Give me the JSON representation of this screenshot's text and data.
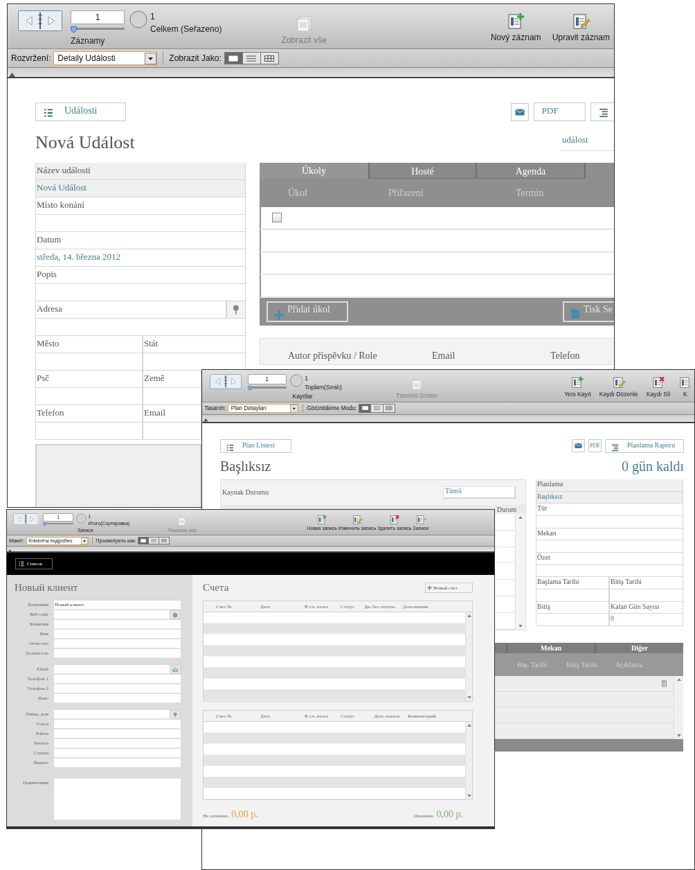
{
  "event_window": {
    "toolbar": {
      "record": "1",
      "level": 0,
      "total": "1",
      "sort_label": "Celkem (Seřazeno)",
      "records_label": "Záznamy",
      "show_all": {
        "label": "Zobrazit vše",
        "disabled": true
      },
      "actions": [
        {
          "kind": "new",
          "label": "Nový záznam"
        },
        {
          "kind": "edit",
          "label": "Upravit záznam"
        }
      ]
    },
    "layout_bar": {
      "layout_label": "Rozvržení:",
      "layout": "Detaily Události",
      "view_label": "Zobrazit Jako:",
      "views": [
        {
          "kind": "form",
          "selected": true
        },
        {
          "kind": "list",
          "selected": false
        },
        {
          "kind": "table",
          "selected": false
        }
      ]
    },
    "list_button": "Události",
    "pdf_button": "PDF",
    "title": "Nová Událost",
    "type_field": "událost",
    "fields": [
      {
        "kind": "shaded",
        "label": "Název události",
        "value": "Nová Událost"
      },
      {
        "kind": "plain",
        "label": "Místo konání"
      },
      {
        "kind": "plain",
        "label": "Datum",
        "value": "středa, 14. března 2012"
      },
      {
        "kind": "plain",
        "label": "Popis"
      },
      {
        "kind": "address",
        "label": "Adresa"
      },
      {
        "kind": "pair",
        "labels": [
          "Město",
          "Stát"
        ]
      },
      {
        "kind": "pair",
        "labels": [
          "Psč",
          "Země"
        ]
      },
      {
        "kind": "pair",
        "labels": [
          "Telefon",
          "Email"
        ]
      }
    ],
    "tasks": {
      "tabs": [
        {
          "label": "Úkoly",
          "selected": true
        },
        {
          "label": "Hosté",
          "selected": false
        },
        {
          "label": "Agenda",
          "selected": false
        }
      ],
      "columns": [
        "Úkol",
        "Přiřazeni",
        "Termin"
      ],
      "rows": [
        {
          "checked": false
        }
      ],
      "add_button": "Přidat úkol",
      "print_button": "Tisk Se"
    },
    "contacts": {
      "columns": [
        "Autor příspěvku / Role",
        "Email",
        "Telefon"
      ]
    }
  },
  "plan_window": {
    "toolbar": {
      "record": "1",
      "level": 0,
      "total": "1",
      "sort_label": "Toplam(Sıralı)",
      "records_label": "Kayıtlar",
      "show_all": {
        "label": "Tümünü Göster",
        "disabled": true
      },
      "actions": [
        {
          "kind": "new",
          "label": "Yeni Kayıt"
        },
        {
          "kind": "edit",
          "label": "Kaydı Düzenle"
        },
        {
          "kind": "delete",
          "label": "Kaydı Sil"
        },
        {
          "kind": "plain",
          "label": "K"
        }
      ]
    },
    "layout_bar": {
      "layout_label": "Tasarım:",
      "layout": "Plan Detayları",
      "view_label": "Görüntüleme Modu:",
      "views": [
        {
          "kind": "form",
          "selected": true
        },
        {
          "kind": "list",
          "selected": false
        },
        {
          "kind": "table",
          "selected": false
        }
      ]
    },
    "list_button": "Plan Listesi",
    "pdf_button": "PDF",
    "report_button": "Planlama Raporu",
    "title": "Başlıksız",
    "days_left": "0 gün kaldı",
    "resources": {
      "label": "Kaynak Durumu",
      "filter": "Tümü",
      "column": "Durum"
    },
    "fields": [
      {
        "kind": "shaded",
        "label": "Planlama",
        "value": "Başlıksız"
      },
      {
        "kind": "plain",
        "label": "Tür"
      },
      {
        "kind": "plain",
        "label": "Mekan"
      },
      {
        "kind": "plain",
        "label": "Özet"
      },
      {
        "kind": "pair",
        "labels": [
          "Başlama Tarihi",
          "Bitiş Tarihi"
        ]
      },
      {
        "kind": "pair",
        "labels": [
          "Bitiş",
          "Kalan Gün Sayısı"
        ],
        "right_value": "0"
      }
    ],
    "portal": {
      "tabs": [
        {
          "label": "Mekan",
          "selected": false
        },
        {
          "label": "Diğer",
          "selected": false
        }
      ],
      "columns": [
        "Baş. Tarihi",
        "Bitiş Tarihi",
        "Açıklama"
      ]
    }
  },
  "client_window": {
    "toolbar": {
      "record": "1",
      "level": 0,
      "total": "1",
      "sort_label": "Итого(Сортировка)",
      "records_label": "Записи",
      "show_all": {
        "label": "Показать все",
        "disabled": true
      },
      "actions": [
        {
          "kind": "new",
          "label": "Новая запись"
        },
        {
          "kind": "edit",
          "label": "Изменить запись"
        },
        {
          "kind": "delete",
          "label": "Удалить запись"
        },
        {
          "kind": "menu",
          "label": "Записи"
        }
      ]
    },
    "layout_bar": {
      "layout_label": "Макет:",
      "layout": "Клиенты подробно",
      "view_label": "Просмотреть как:",
      "views": [
        {
          "kind": "form",
          "selected": true
        },
        {
          "kind": "list",
          "selected": false
        },
        {
          "kind": "table",
          "selected": false
        }
      ]
    },
    "list_button": "Список",
    "title": "Новый клиент",
    "field_groups": [
      [
        {
          "kind": "text",
          "label": "Компания",
          "value": "Новый клиент"
        },
        {
          "kind": "web",
          "label": "Веб-сайт"
        },
        {
          "kind": "text",
          "label": "Фамилия"
        },
        {
          "kind": "text",
          "label": "Имя"
        },
        {
          "kind": "text",
          "label": "Отчество"
        },
        {
          "kind": "text",
          "label": "Должность"
        }
      ],
      [
        {
          "kind": "email",
          "label": "Email"
        },
        {
          "kind": "text",
          "label": "Телефон 1"
        },
        {
          "kind": "text",
          "label": "Телефон 2"
        },
        {
          "kind": "text",
          "label": "Факс"
        }
      ],
      [
        {
          "kind": "address",
          "label": "Улица, дом"
        },
        {
          "kind": "text",
          "label": "Город"
        },
        {
          "kind": "text",
          "label": "Район"
        },
        {
          "kind": "text",
          "label": "Регион"
        },
        {
          "kind": "text",
          "label": "Страна"
        },
        {
          "kind": "text",
          "label": "Индекс"
        }
      ],
      [
        {
          "kind": "notes",
          "label": "Примечания"
        }
      ]
    ],
    "invoices": {
      "title": "Счета",
      "new_button": "Новый счет",
      "tables": [
        {
          "columns": [
            "Счет №",
            "Дата",
            "В т.ч. налог",
            "Статус",
            "Дн. без оплаты",
            "Дополнения"
          ]
        },
        {
          "columns": [
            "Счет №",
            "Дата",
            "В т.ч. налог",
            "Статус",
            "Дата оплаты",
            "Комментарий"
          ]
        }
      ],
      "unpaid": {
        "label": "Не оплачено",
        "amount": "0,00 р."
      },
      "paid": {
        "label": "Оплачено",
        "amount": "0,00 р."
      }
    }
  }
}
